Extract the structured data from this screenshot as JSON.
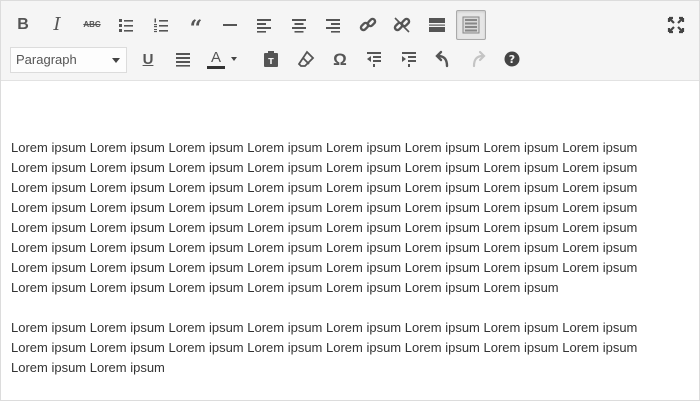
{
  "toolbar": {
    "row1": [
      {
        "name": "bold-button",
        "icon": "bold-icon",
        "glyph": "B"
      },
      {
        "name": "italic-button",
        "icon": "italic-icon",
        "glyph": "I"
      },
      {
        "name": "strikethrough-button",
        "icon": "strikethrough-icon",
        "glyph": "ABC"
      },
      {
        "name": "bulleted-list-button",
        "icon": "bulleted-list-icon"
      },
      {
        "name": "numbered-list-button",
        "icon": "numbered-list-icon"
      },
      {
        "name": "blockquote-button",
        "icon": "blockquote-icon",
        "glyph": "“"
      },
      {
        "name": "horizontal-line-button",
        "icon": "horizontal-line-icon"
      },
      {
        "name": "align-left-button",
        "icon": "align-left-icon"
      },
      {
        "name": "align-center-button",
        "icon": "align-center-icon"
      },
      {
        "name": "align-right-button",
        "icon": "align-right-icon"
      },
      {
        "name": "insert-link-button",
        "icon": "link-icon"
      },
      {
        "name": "remove-link-button",
        "icon": "unlink-icon"
      },
      {
        "name": "read-more-button",
        "icon": "read-more-icon"
      },
      {
        "name": "toolbar-toggle-button",
        "icon": "kitchen-sink-icon",
        "active": true
      }
    ],
    "fullscreen_icon": "fullscreen-icon",
    "format_select": {
      "value": "Paragraph"
    },
    "row2": [
      {
        "name": "underline-button",
        "icon": "underline-icon",
        "glyph": "U"
      },
      {
        "name": "justify-button",
        "icon": "justify-icon"
      },
      {
        "name": "text-color-button",
        "icon": "text-color-icon",
        "glyph": "A"
      },
      {
        "name": "paste-as-text-button",
        "icon": "paste-text-icon"
      },
      {
        "name": "clear-formatting-button",
        "icon": "eraser-icon"
      },
      {
        "name": "special-character-button",
        "icon": "omega-icon",
        "glyph": "Ω"
      },
      {
        "name": "outdent-button",
        "icon": "outdent-icon"
      },
      {
        "name": "indent-button",
        "icon": "indent-icon"
      },
      {
        "name": "undo-button",
        "icon": "undo-icon"
      },
      {
        "name": "redo-button",
        "icon": "redo-icon",
        "disabled": true
      },
      {
        "name": "help-button",
        "icon": "help-icon"
      }
    ]
  },
  "colors": {
    "text_color_underline": "#333333",
    "active_border": "#aaaaaa"
  },
  "content": {
    "paragraphs": [
      [
        "Lorem ipsum Lorem ipsum Lorem ipsum Lorem ipsum Lorem ipsum Lorem ipsum Lorem ipsum Lorem ipsum",
        "Lorem ipsum Lorem ipsum Lorem ipsum Lorem ipsum Lorem ipsum Lorem ipsum Lorem ipsum Lorem ipsum",
        "Lorem ipsum Lorem ipsum Lorem ipsum Lorem ipsum Lorem ipsum Lorem ipsum Lorem ipsum Lorem ipsum",
        "Lorem ipsum Lorem ipsum Lorem ipsum Lorem ipsum Lorem ipsum Lorem ipsum Lorem ipsum Lorem ipsum",
        "Lorem ipsum Lorem ipsum Lorem ipsum Lorem ipsum Lorem ipsum Lorem ipsum Lorem ipsum Lorem ipsum",
        "Lorem ipsum Lorem ipsum Lorem ipsum Lorem ipsum Lorem ipsum Lorem ipsum Lorem ipsum Lorem ipsum",
        "Lorem ipsum Lorem ipsum Lorem ipsum Lorem ipsum Lorem ipsum Lorem ipsum Lorem ipsum Lorem ipsum",
        "Lorem ipsum Lorem ipsum Lorem ipsum Lorem ipsum Lorem ipsum Lorem ipsum Lorem ipsum"
      ],
      [
        "Lorem ipsum Lorem ipsum Lorem ipsum Lorem ipsum Lorem ipsum Lorem ipsum Lorem ipsum Lorem ipsum",
        "Lorem ipsum Lorem ipsum Lorem ipsum Lorem ipsum Lorem ipsum Lorem ipsum Lorem ipsum Lorem ipsum",
        "Lorem ipsum Lorem ipsum"
      ]
    ]
  }
}
